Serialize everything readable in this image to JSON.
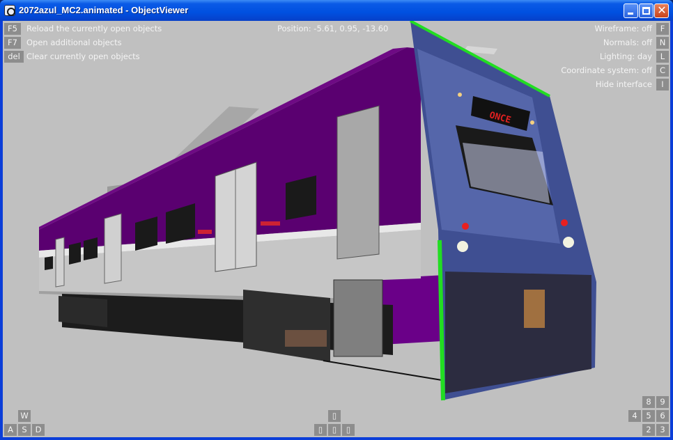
{
  "window": {
    "title": "2072azul_MC2.animated - ObjectViewer",
    "close_glyph": "✕"
  },
  "hud_left": [
    {
      "key": "F5",
      "label": "Reload the currently open objects"
    },
    {
      "key": "F7",
      "label": "Open additional objects"
    },
    {
      "key": "del",
      "label": "Clear currently open objects"
    }
  ],
  "position": {
    "text": "Position: -5.61, 0.95, -13.60"
  },
  "hud_right": [
    {
      "key": "F",
      "label": "Wireframe: off"
    },
    {
      "key": "N",
      "label": "Normals: off"
    },
    {
      "key": "L",
      "label": "Lighting: day"
    },
    {
      "key": "C",
      "label": "Coordinate system: off"
    },
    {
      "key": "I",
      "label": "Hide interface"
    }
  ],
  "move_keys": {
    "w": "W",
    "a": "A",
    "s": "S",
    "d": "D"
  },
  "center_pad": {
    "up": "▯",
    "left": "▯",
    "mid": "▯",
    "right": "▯"
  },
  "numpad": {
    "k8": "8",
    "k9": "9",
    "k4": "4",
    "k5": "5",
    "k6": "6",
    "k2": "2",
    "k3": "3"
  },
  "train": {
    "destination_sign": "ONCE"
  },
  "colors": {
    "body": "#5a0070",
    "skirt": "#c4c4c4",
    "cab": "#4b5aa0",
    "outline": "#22dd22"
  }
}
